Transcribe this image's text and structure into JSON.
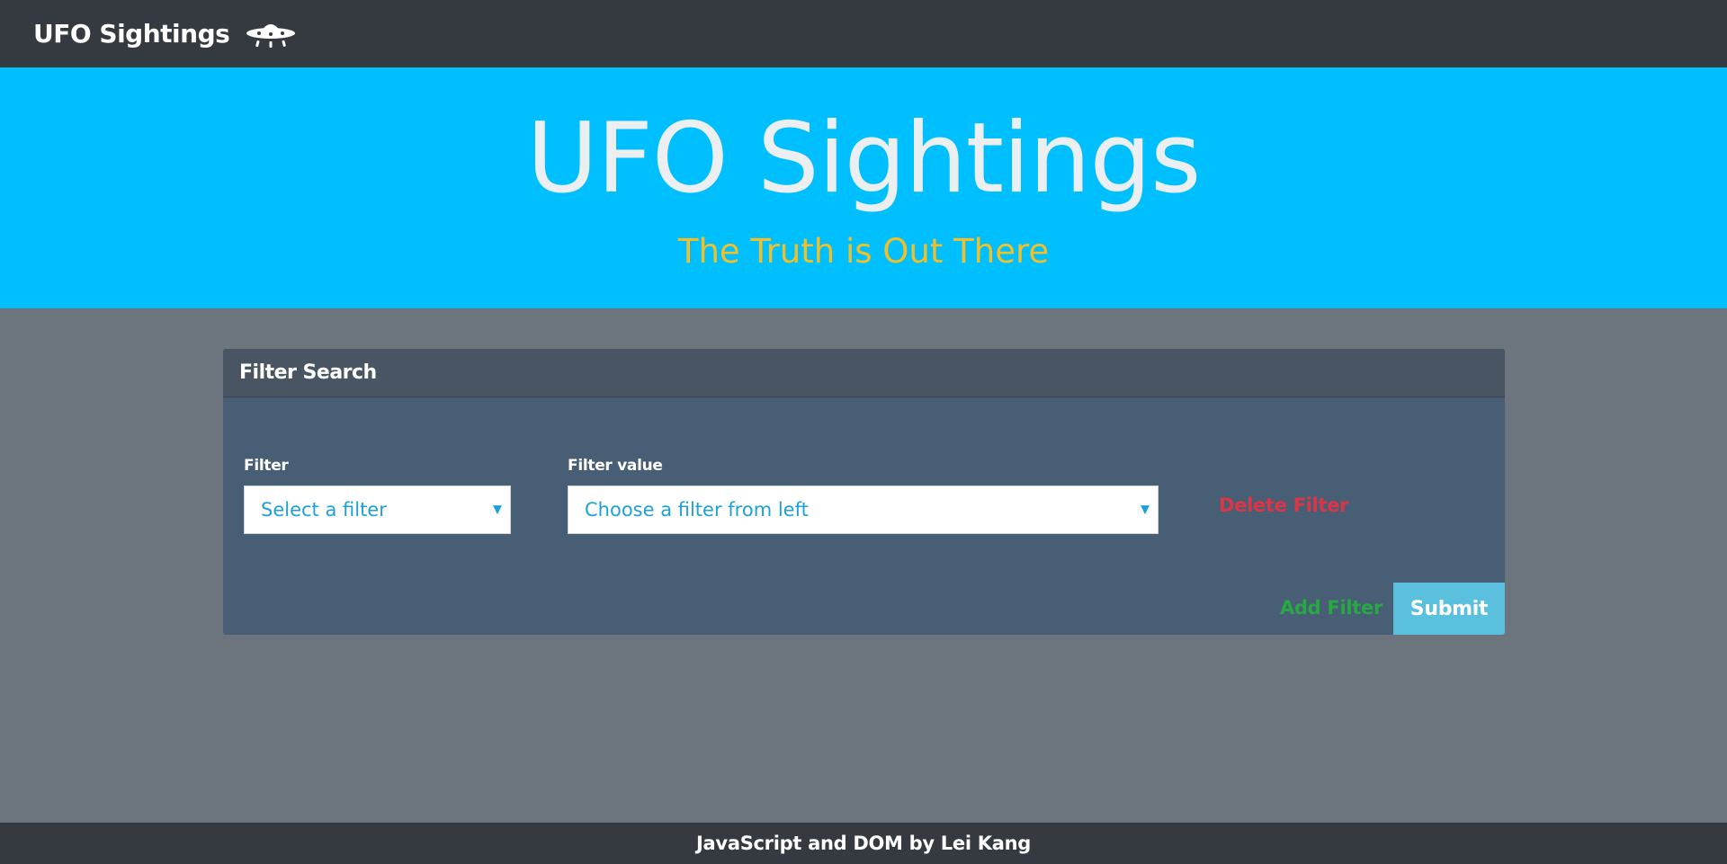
{
  "navbar": {
    "brand": "UFO Sightings",
    "icon": "ufo-icon"
  },
  "hero": {
    "title": "UFO Sightings",
    "subtitle": "The Truth is Out There"
  },
  "filter_panel": {
    "title": "Filter Search",
    "filter": {
      "label": "Filter",
      "selected": "Select a filter"
    },
    "filter_value": {
      "label": "Filter value",
      "selected": "Choose a filter from left"
    },
    "delete_label": "Delete Filter",
    "add_label": "Add Filter",
    "submit_label": "Submit"
  },
  "footer": {
    "text": "JavaScript and DOM by Lei Kang"
  },
  "colors": {
    "navbar": "#343a40",
    "hero": "#00bfff",
    "subtitle": "#f0c02a",
    "page_bg": "#6c757d",
    "panel_bg": "#485e74",
    "delete": "#dc3545",
    "add": "#28a745",
    "submit": "#5bc0de",
    "select_text": "#1ea1d6"
  }
}
